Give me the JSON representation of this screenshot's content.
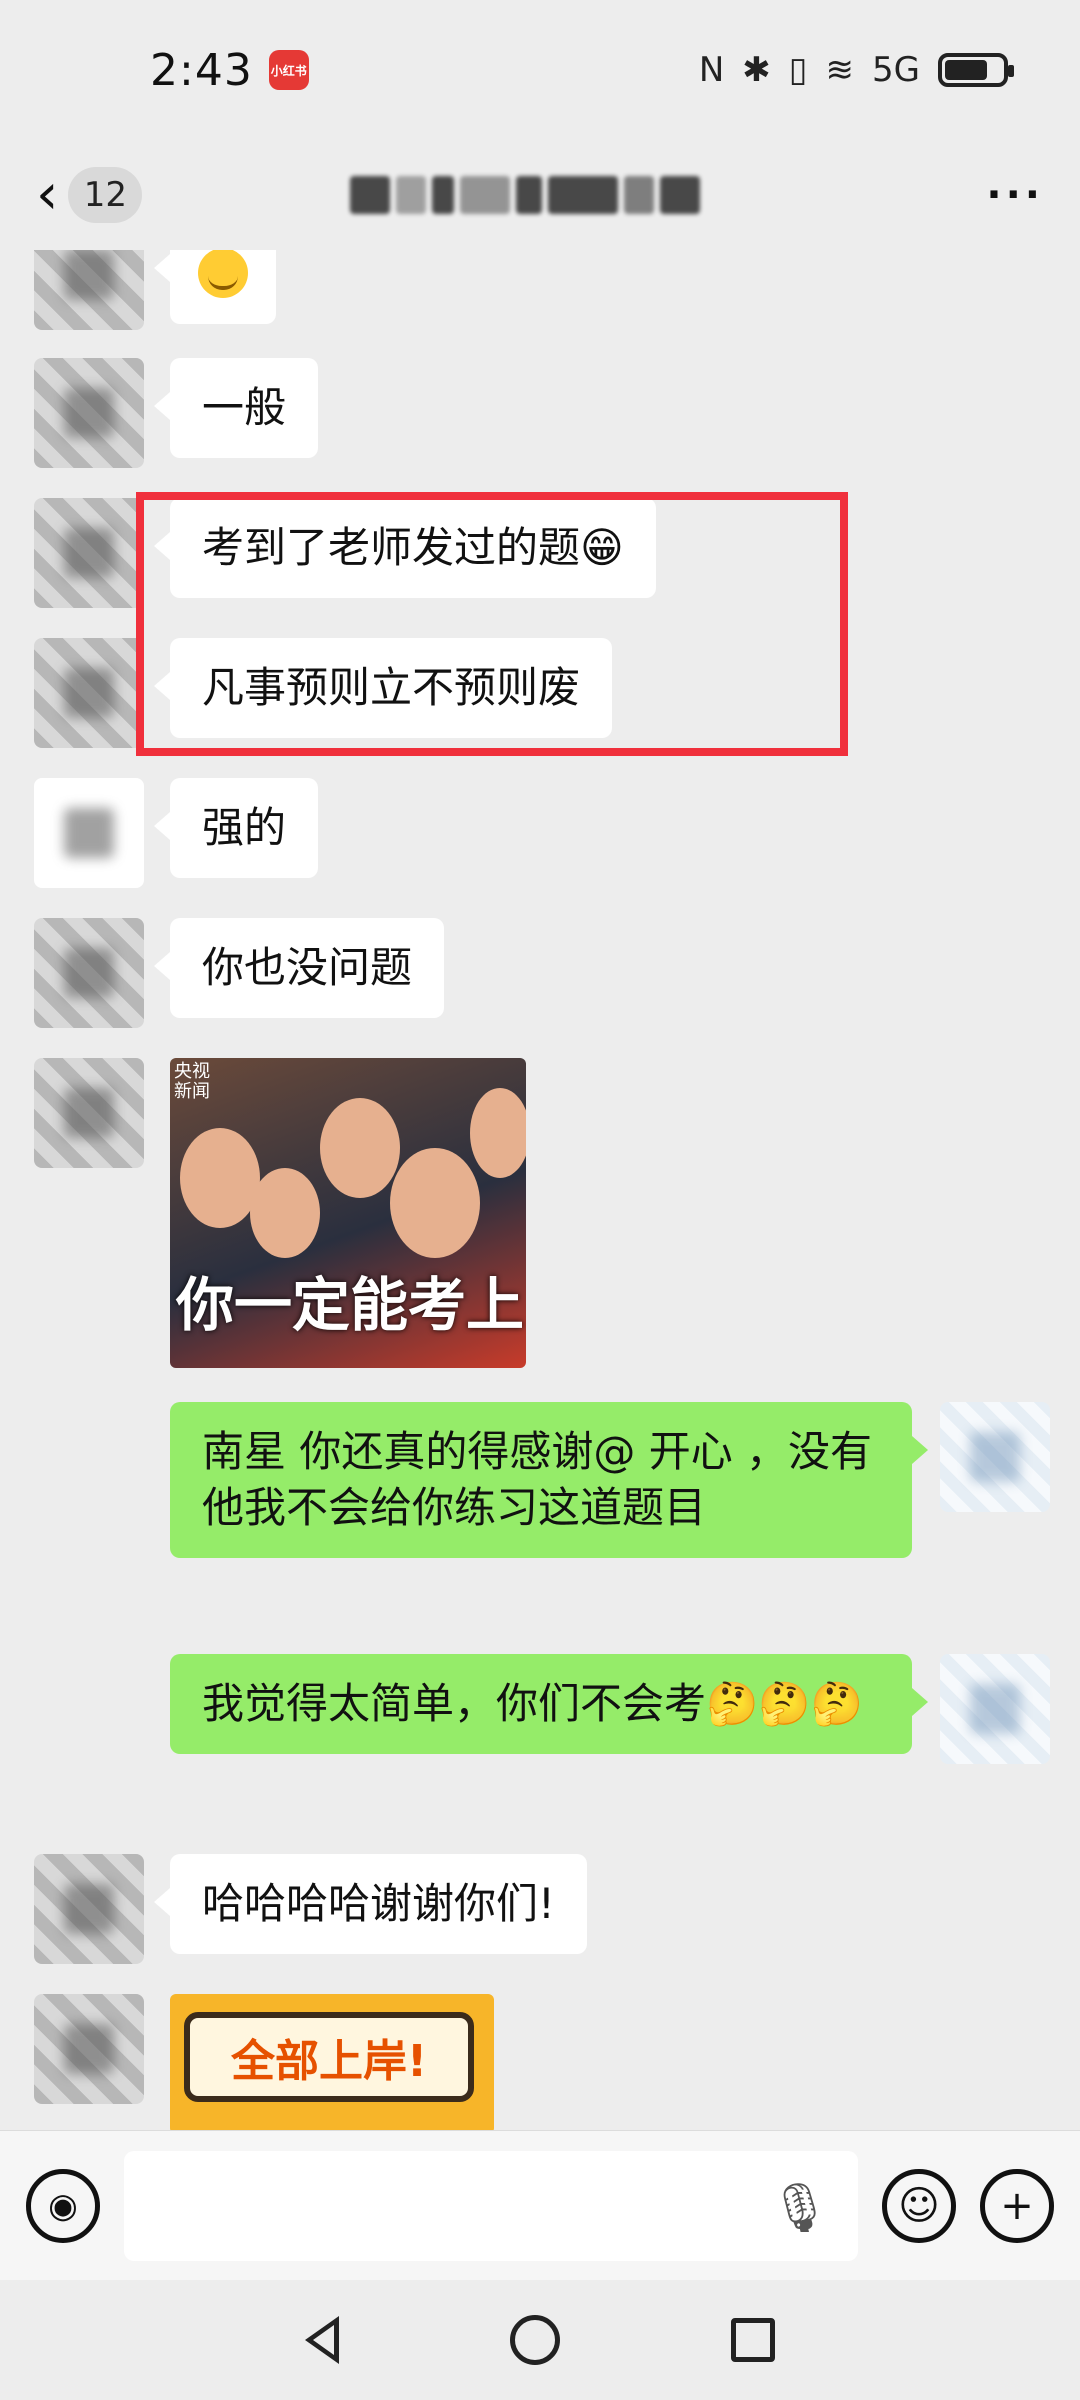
{
  "status_bar": {
    "time": "2:43",
    "app_badge": "小红书",
    "indicators": [
      "N",
      "✱",
      "▯",
      "≋",
      "5G"
    ]
  },
  "header": {
    "unread_count": "12",
    "more_label": "···"
  },
  "messages": [
    {
      "side": "left",
      "text": "",
      "has_emoji": true
    },
    {
      "side": "left",
      "text": "一般"
    },
    {
      "side": "left",
      "text": "考到了老师发过的题😁"
    },
    {
      "side": "left",
      "text": "凡事预则立不预则废"
    },
    {
      "side": "left",
      "text": "强的"
    },
    {
      "side": "left",
      "text": "你也没问题"
    },
    {
      "side": "left",
      "type": "image",
      "logo": "央视\n新闻",
      "caption": "你一定能考上"
    },
    {
      "side": "right",
      "text": "南星  你还真的得感谢@      开心 ，没有他我不会给你练习这道题目"
    },
    {
      "side": "right",
      "text": "我觉得太简单，你们不会考🤔🤔🤔"
    },
    {
      "side": "left",
      "text": "哈哈哈哈谢谢你们!"
    },
    {
      "side": "left",
      "type": "image",
      "caption": "全部上岸!"
    }
  ],
  "input_bar": {
    "voice_icon": "voice-icon",
    "placeholder": "",
    "emoji_icon": "☺",
    "plus_icon": "+"
  },
  "colors": {
    "background": "#ededed",
    "bubble_in": "#ffffff",
    "bubble_out": "#95ec69",
    "highlight": "#f0303c"
  }
}
